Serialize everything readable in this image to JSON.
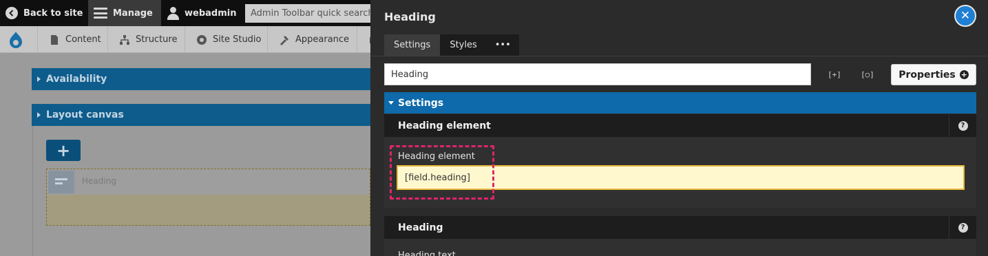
{
  "toolbar": {
    "back_label": "Back to site",
    "manage_label": "Manage",
    "user_label": "webadmin",
    "search_placeholder": "Admin Toolbar quick search"
  },
  "nav": {
    "items": [
      {
        "label": "Content",
        "icon": "page-icon"
      },
      {
        "label": "Structure",
        "icon": "structure-icon"
      },
      {
        "label": "Site Studio",
        "icon": "site-studio-icon"
      },
      {
        "label": "Appearance",
        "icon": "appearance-icon"
      }
    ]
  },
  "page": {
    "availability_label": "Availability",
    "layout_canvas_label": "Layout canvas",
    "add_symbol": "+",
    "component_label": "Heading"
  },
  "modal": {
    "title": "Heading",
    "close_symbol": "✕",
    "tabs": [
      {
        "label": "Settings",
        "active": true
      },
      {
        "label": "Styles",
        "active": false
      },
      {
        "label": "•••",
        "active": false
      }
    ],
    "name_value": "Heading",
    "expand_symbol": "[+]",
    "search_symbol": "[○]",
    "properties_label": "Properties",
    "properties_icon": "+",
    "settings_label": "Settings",
    "sections": [
      {
        "title": "Heading element",
        "help": "?"
      },
      {
        "title": "Heading",
        "help": "?"
      }
    ],
    "field_label": "Heading element",
    "field_value": "[field.heading]",
    "cut_text": "Heading text"
  },
  "colors": {
    "accent": "#0e6aaa",
    "highlight": "#e0246a",
    "field_bg": "#fff8cf"
  }
}
